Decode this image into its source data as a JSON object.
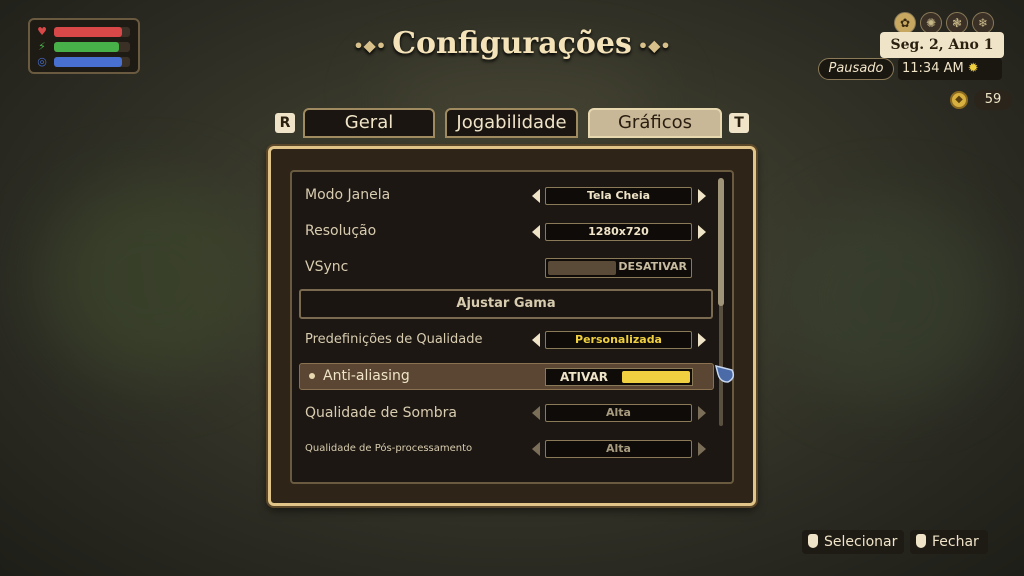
{
  "title": "Configurações",
  "hud": {
    "health": 0.9,
    "stamina": 0.85,
    "mana": 0.9
  },
  "calendar": {
    "date": "Seg. 2, Ano 1",
    "paused_label": "Pausado",
    "time": "11:34 AM",
    "seasons": [
      "spring-flower-icon",
      "summer-sun-icon",
      "fall-leaf-icon",
      "winter-snowflake-icon"
    ]
  },
  "coins": "59",
  "tabs": {
    "left_key": "R",
    "right_key": "T",
    "items": [
      {
        "label": "Geral"
      },
      {
        "label": "Jogabilidade"
      },
      {
        "label": "Gráficos"
      }
    ],
    "active": "Gráficos"
  },
  "settings": {
    "window_mode": {
      "label": "Modo Janela",
      "value": "Tela Cheia"
    },
    "resolution": {
      "label": "Resolução",
      "value": "1280x720"
    },
    "vsync": {
      "label": "VSync",
      "value": "DESATIVAR"
    },
    "gamma_button": "Ajustar Gama",
    "quality_preset": {
      "label": "Predefinições de Qualidade",
      "value": "Personalizada"
    },
    "anti_aliasing": {
      "label": "Anti-aliasing",
      "value": "ATIVAR"
    },
    "shadow_quality": {
      "label": "Qualidade de Sombra",
      "value": "Alta"
    },
    "post_processing": {
      "label": "Qualidade de Pós-processamento",
      "value": "Alta"
    }
  },
  "hints": {
    "select": "Selecionar",
    "close": "Fechar"
  },
  "colors": {
    "accent_gold": "#e0c488",
    "toggle_on": "#f0d040",
    "health": "#d84848",
    "stamina": "#48b048",
    "mana": "#4870d0"
  }
}
